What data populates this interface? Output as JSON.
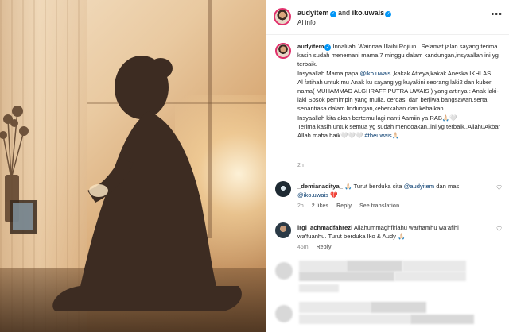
{
  "header": {
    "user1": "audyitem",
    "and": "and",
    "user2": "iko.uwais",
    "subtitle": "AI info",
    "more": "•••"
  },
  "caption": {
    "username": "audyitem",
    "lines": [
      "Innalilahi Wainnaa Illaihi Rojiun.. Selamat jalan sayang terima kasih sudah menemani mama 7 minggu dalam kandungan,insyaallah ini yg terbaik.",
      "Insyaallah Mama,papa ",
      "@iko.uwais",
      " ,kakak Atreya,kakak Aneska IKHLAS.",
      "Al fatihah untuk mu Anak ku sayang yg kuyakini seorang laki2 dan kuberi nama( MUHAMMAD ALGHRAFF PUTRA UWAIS ) yang artinya : Anak laki-laki Sosok pemimpin yang mulia, cerdas, dan berjiwa bangsawan,serta senantiasa dalam lindungan,keberkahan dan kebaikan.",
      "Insyaallah kita akan bertemu lagi nanti Aamiin ya RAB🙏🏻🤍",
      "Terima kasih untuk semua yg sudah mendoakan..ini yg terbaik..AllahuAkbar Allah maha baik🤍🤍🤍 ",
      "#theuwais",
      "🙏🏻"
    ],
    "time": "2h"
  },
  "comments": [
    {
      "username": "_demianaditya_",
      "text_before": " 🙏🏻 Turut berduka cita ",
      "mention1": "@audyitem",
      "text_mid": " dan mas ",
      "mention2": "@iko.uwais",
      "text_after": " 💔",
      "time": "2h",
      "likes": "2 likes",
      "reply": "Reply",
      "see_translation": "See translation"
    },
    {
      "username": "irgi_achmadfahrezi",
      "text": " Allahummaghfirlahu warhamhu wa'afihi wa'fuanhu. Turut berduka Iko & Audy 🙏🏻",
      "time": "46m",
      "reply": "Reply"
    }
  ],
  "icons": {
    "heart": "♡"
  }
}
